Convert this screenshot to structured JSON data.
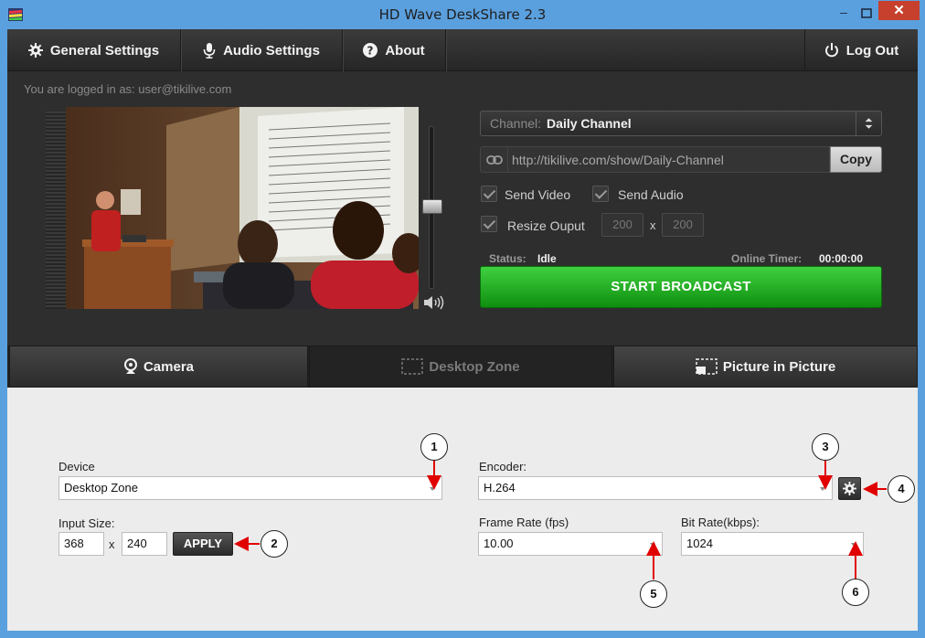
{
  "window": {
    "title": "HD Wave DeskShare 2.3",
    "close_glyph": "✕",
    "minimize_glyph": "–"
  },
  "nav": {
    "general_settings": "General Settings",
    "audio_settings": "Audio Settings",
    "about": "About",
    "log_out": "Log Out"
  },
  "session": {
    "logged_in_text": "You are logged in as: user@tikilive.com"
  },
  "channel": {
    "label": "Channel:",
    "value": "Daily Channel"
  },
  "share": {
    "url": "http://tikilive.com/show/Daily-Channel",
    "copy_label": "Copy"
  },
  "options": {
    "send_video": "Send Video",
    "send_audio": "Send Audio",
    "resize_output": "Resize Ouput",
    "resize_width": "200",
    "resize_height": "200",
    "resize_x": "x"
  },
  "status": {
    "label": "Status:",
    "value": "Idle",
    "timer_label": "Online Timer:",
    "timer_value": "00:00:00"
  },
  "broadcast": {
    "start_label": "START BROADCAST"
  },
  "tabs": {
    "camera": "Camera",
    "desktop_zone": "Desktop Zone",
    "picture_in_picture": "Picture in Picture",
    "active": "Desktop Zone"
  },
  "desktop_settings": {
    "device_label": "Device",
    "device_value": "Desktop Zone",
    "input_size_label": "Input Size:",
    "input_width": "368",
    "input_height": "240",
    "size_x": "x",
    "apply_label": "APPLY",
    "encoder_label": "Encoder:",
    "encoder_value": "H.264",
    "frame_rate_label": "Frame Rate (fps)",
    "frame_rate_value": "10.00",
    "bit_rate_label": "Bit Rate(kbps):",
    "bit_rate_value": "1024"
  },
  "callouts": [
    "1",
    "2",
    "3",
    "4",
    "5",
    "6"
  ],
  "colors": {
    "accent_green": "#1aa81a",
    "window_frame": "#5ba0de",
    "close_red": "#c7402d",
    "callout_arrow": "#e00000",
    "dark_panel": "#2e2e2e"
  },
  "icons": [
    "gear-icon",
    "microphone-icon",
    "help-icon",
    "power-icon",
    "link-icon",
    "volume-icon",
    "webcam-icon",
    "desktop-zone-icon",
    "pip-icon"
  ]
}
